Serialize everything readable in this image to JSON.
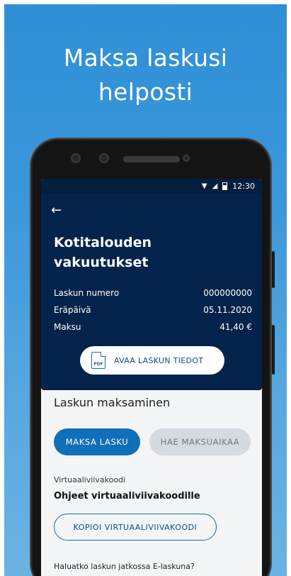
{
  "promo": {
    "headline_line1": "Maksa laskusi",
    "headline_line2": "helposti"
  },
  "statusbar": {
    "time": "12:30",
    "icons": [
      "wifi-icon",
      "signal-icon",
      "battery-icon"
    ]
  },
  "invoice": {
    "back_icon": "back-arrow-icon",
    "title_line1": "Kotitalouden",
    "title_line2": "vakuutukset",
    "rows": [
      {
        "label": "Laskun numero",
        "value": "000000000"
      },
      {
        "label": "Eräpäivä",
        "value": "05.11.2020"
      },
      {
        "label": "Maksu",
        "value": "41,40 €"
      }
    ],
    "pdf_button": {
      "icon_text": "PDF",
      "label": "AVAA LASKUN TIEDOT"
    }
  },
  "payment": {
    "section_title": "Laskun maksaminen",
    "pay_button": "MAKSA LASKU",
    "schedule_button": "HAE MAKSUAIKAA",
    "virtual_label": "Virtuaaliviivakoodi",
    "virtual_instructions": "Ohjeet virtuaaliviivakoodille",
    "copy_button": "KOPIOI VIRTUAALIVIIVAKOODI",
    "einvoice_question": "Haluatko laskun jatkossa E-laskuna?"
  },
  "colors": {
    "gradient_top": "#2f8fd6",
    "header_navy": "#04234a",
    "primary_blue": "#0f6fb8",
    "disabled_grey": "#d5dbe0"
  }
}
